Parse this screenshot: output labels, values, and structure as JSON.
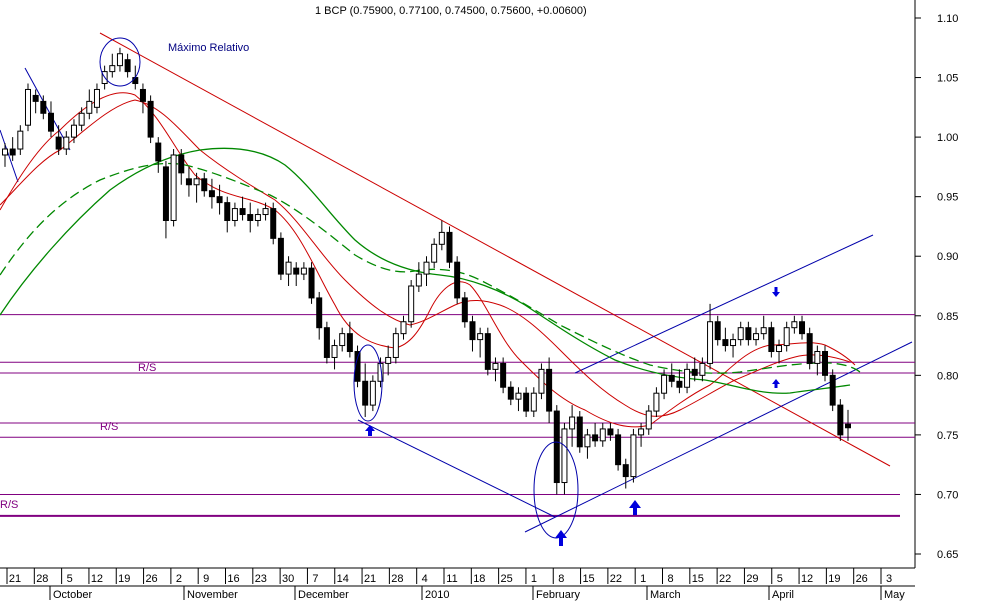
{
  "chart_data": {
    "type": "candlestick",
    "title": "1 BCP (0.75900, 0.77100, 0.74500, 0.75600, +0.00600)",
    "y_ticks": [
      "1.10",
      "1.05",
      "1.00",
      "0.95",
      "0.90",
      "0.85",
      "0.80",
      "0.75",
      "0.70",
      "0.65"
    ],
    "ylim": [
      0.63,
      1.11
    ],
    "x_day_labels": [
      "21",
      "28",
      "5",
      "12",
      "19",
      "26",
      "2",
      "9",
      "16",
      "23",
      "30",
      "7",
      "14",
      "21",
      "28",
      "4",
      "11",
      "18",
      "25",
      "1",
      "8",
      "15",
      "22",
      "1",
      "8",
      "15",
      "22",
      "29",
      "5",
      "12",
      "19",
      "26",
      "3"
    ],
    "x_month_labels": [
      "October",
      "November",
      "December",
      "2010",
      "February",
      "March",
      "April",
      "May"
    ],
    "annotations": {
      "max_label": "Máximo Relativo",
      "rs_label_1": "R/S",
      "rs_label_2": "R/S",
      "rs_label_3": "R/S"
    },
    "horizontal_levels": [
      0.851,
      0.811,
      0.802,
      0.76,
      0.748,
      0.7,
      0.682
    ],
    "candles": [
      [
        0.985,
        0.995,
        0.975,
        0.99
      ],
      [
        0.99,
        1.0,
        0.98,
        0.985
      ],
      [
        0.99,
        1.01,
        0.985,
        1.005
      ],
      [
        1.01,
        1.045,
        1.005,
        1.04
      ],
      [
        1.035,
        1.04,
        1.02,
        1.03
      ],
      [
        1.03,
        1.035,
        1.015,
        1.02
      ],
      [
        1.02,
        1.03,
        1.0,
        1.005
      ],
      [
        1.0,
        1.01,
        0.985,
        0.99
      ],
      [
        0.99,
        1.005,
        0.985,
        1.0
      ],
      [
        1.0,
        1.015,
        0.995,
        1.01
      ],
      [
        1.01,
        1.025,
        1.005,
        1.02
      ],
      [
        1.02,
        1.04,
        1.015,
        1.03
      ],
      [
        1.025,
        1.045,
        1.02,
        1.04
      ],
      [
        1.045,
        1.06,
        1.04,
        1.055
      ],
      [
        1.055,
        1.07,
        1.05,
        1.06
      ],
      [
        1.06,
        1.075,
        1.055,
        1.07
      ],
      [
        1.065,
        1.07,
        1.05,
        1.055
      ],
      [
        1.05,
        1.06,
        1.04,
        1.045
      ],
      [
        1.04,
        1.045,
        1.02,
        1.03
      ],
      [
        1.03,
        1.035,
        0.995,
        1.0
      ],
      [
        0.995,
        1.0,
        0.97,
        0.98
      ],
      [
        0.975,
        0.98,
        0.915,
        0.93
      ],
      [
        0.93,
        0.99,
        0.925,
        0.985
      ],
      [
        0.985,
        0.99,
        0.96,
        0.97
      ],
      [
        0.965,
        0.975,
        0.95,
        0.96
      ],
      [
        0.96,
        0.97,
        0.945,
        0.965
      ],
      [
        0.965,
        0.97,
        0.95,
        0.955
      ],
      [
        0.955,
        0.965,
        0.94,
        0.95
      ],
      [
        0.95,
        0.96,
        0.935,
        0.945
      ],
      [
        0.945,
        0.95,
        0.92,
        0.93
      ],
      [
        0.93,
        0.945,
        0.925,
        0.94
      ],
      [
        0.94,
        0.95,
        0.93,
        0.935
      ],
      [
        0.935,
        0.945,
        0.92,
        0.93
      ],
      [
        0.93,
        0.94,
        0.925,
        0.935
      ],
      [
        0.935,
        0.945,
        0.93,
        0.94
      ],
      [
        0.94,
        0.945,
        0.91,
        0.915
      ],
      [
        0.915,
        0.92,
        0.88,
        0.885
      ],
      [
        0.885,
        0.9,
        0.875,
        0.895
      ],
      [
        0.89,
        0.895,
        0.875,
        0.885
      ],
      [
        0.885,
        0.895,
        0.88,
        0.89
      ],
      [
        0.89,
        0.895,
        0.86,
        0.865
      ],
      [
        0.865,
        0.87,
        0.83,
        0.84
      ],
      [
        0.84,
        0.845,
        0.81,
        0.815
      ],
      [
        0.815,
        0.83,
        0.805,
        0.825
      ],
      [
        0.825,
        0.84,
        0.82,
        0.835
      ],
      [
        0.835,
        0.845,
        0.815,
        0.82
      ],
      [
        0.82,
        0.825,
        0.79,
        0.795
      ],
      [
        0.795,
        0.81,
        0.765,
        0.775
      ],
      [
        0.775,
        0.8,
        0.77,
        0.795
      ],
      [
        0.795,
        0.815,
        0.79,
        0.81
      ],
      [
        0.81,
        0.825,
        0.8,
        0.815
      ],
      [
        0.815,
        0.84,
        0.81,
        0.835
      ],
      [
        0.835,
        0.85,
        0.83,
        0.845
      ],
      [
        0.845,
        0.88,
        0.84,
        0.875
      ],
      [
        0.875,
        0.895,
        0.87,
        0.885
      ],
      [
        0.885,
        0.9,
        0.875,
        0.895
      ],
      [
        0.895,
        0.915,
        0.89,
        0.91
      ],
      [
        0.91,
        0.93,
        0.905,
        0.92
      ],
      [
        0.92,
        0.925,
        0.89,
        0.895
      ],
      [
        0.895,
        0.9,
        0.86,
        0.865
      ],
      [
        0.865,
        0.87,
        0.84,
        0.845
      ],
      [
        0.845,
        0.85,
        0.82,
        0.83
      ],
      [
        0.83,
        0.84,
        0.815,
        0.835
      ],
      [
        0.835,
        0.84,
        0.8,
        0.805
      ],
      [
        0.805,
        0.815,
        0.795,
        0.81
      ],
      [
        0.81,
        0.815,
        0.785,
        0.79
      ],
      [
        0.79,
        0.795,
        0.775,
        0.78
      ],
      [
        0.78,
        0.79,
        0.77,
        0.785
      ],
      [
        0.785,
        0.79,
        0.765,
        0.77
      ],
      [
        0.77,
        0.79,
        0.765,
        0.785
      ],
      [
        0.785,
        0.81,
        0.78,
        0.805
      ],
      [
        0.805,
        0.815,
        0.76,
        0.77
      ],
      [
        0.77,
        0.775,
        0.7,
        0.71
      ],
      [
        0.71,
        0.76,
        0.7,
        0.755
      ],
      [
        0.755,
        0.775,
        0.74,
        0.765
      ],
      [
        0.765,
        0.77,
        0.735,
        0.74
      ],
      [
        0.74,
        0.755,
        0.73,
        0.75
      ],
      [
        0.75,
        0.76,
        0.74,
        0.745
      ],
      [
        0.745,
        0.76,
        0.74,
        0.755
      ],
      [
        0.755,
        0.76,
        0.745,
        0.75
      ],
      [
        0.75,
        0.755,
        0.72,
        0.725
      ],
      [
        0.725,
        0.73,
        0.705,
        0.715
      ],
      [
        0.715,
        0.755,
        0.71,
        0.75
      ],
      [
        0.75,
        0.76,
        0.74,
        0.755
      ],
      [
        0.755,
        0.775,
        0.75,
        0.77
      ],
      [
        0.77,
        0.79,
        0.765,
        0.785
      ],
      [
        0.785,
        0.805,
        0.78,
        0.8
      ],
      [
        0.8,
        0.81,
        0.79,
        0.795
      ],
      [
        0.795,
        0.805,
        0.785,
        0.79
      ],
      [
        0.79,
        0.81,
        0.785,
        0.805
      ],
      [
        0.805,
        0.815,
        0.795,
        0.8
      ],
      [
        0.8,
        0.815,
        0.795,
        0.81
      ],
      [
        0.81,
        0.86,
        0.805,
        0.845
      ],
      [
        0.845,
        0.85,
        0.825,
        0.83
      ],
      [
        0.83,
        0.84,
        0.82,
        0.825
      ],
      [
        0.825,
        0.835,
        0.815,
        0.83
      ],
      [
        0.83,
        0.845,
        0.825,
        0.84
      ],
      [
        0.84,
        0.845,
        0.825,
        0.83
      ],
      [
        0.83,
        0.84,
        0.825,
        0.835
      ],
      [
        0.835,
        0.85,
        0.83,
        0.84
      ],
      [
        0.84,
        0.845,
        0.815,
        0.82
      ],
      [
        0.82,
        0.83,
        0.81,
        0.825
      ],
      [
        0.825,
        0.845,
        0.82,
        0.84
      ],
      [
        0.84,
        0.85,
        0.835,
        0.845
      ],
      [
        0.845,
        0.85,
        0.83,
        0.835
      ],
      [
        0.835,
        0.84,
        0.805,
        0.81
      ],
      [
        0.81,
        0.825,
        0.8,
        0.82
      ],
      [
        0.82,
        0.825,
        0.795,
        0.8
      ],
      [
        0.8,
        0.805,
        0.77,
        0.775
      ],
      [
        0.775,
        0.78,
        0.745,
        0.75
      ],
      [
        0.759,
        0.771,
        0.745,
        0.756
      ]
    ]
  }
}
